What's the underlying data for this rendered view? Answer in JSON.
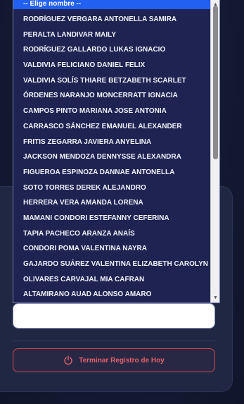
{
  "select": {
    "placeholder": "-- Elige nombre --",
    "options": [
      "RODRÍGUEZ VERGARA ANTONELLA SAMIRA",
      "PERALTA LANDIVAR MAILY",
      "RODRÍGUEZ GALLARDO LUKAS IGNACIO",
      "VALDIVIA FELICIANO DANIEL FELIX",
      "VALDIVIA SOLÍS THIARE BETZABETH SCARLET",
      "ÓRDENES NARANJO MONCERRATT IGNACIA",
      "CAMPOS PINTO MARIANA JOSE ANTONIA",
      "CARRASCO SÁNCHEZ EMANUEL ALEXANDER",
      "FRITIS ZEGARRA JAVIERA ANYELINA",
      "JACKSON MENDOZA DENNYSSE ALEXANDRA",
      "FIGUEROA ESPINOZA DANNAE ANTONELLA",
      "SOTO TORRES DEREK ALEJANDRO",
      "HERRERA VERA AMANDA LORENA",
      "MAMANI CONDORI ESTEFANNY CEFERINA",
      "TAPIA PACHECO ARANZA ANAÍS",
      "CONDORI POMA VALENTINA NAYRA",
      "GAJARDO SUÁREZ VALENTINA ELIZABETH CAROLYN",
      "OLIVARES CARVAJAL MIA CAFRAN",
      "ALTAMIRANO AUAD ALONSO AMARO"
    ]
  },
  "end_button": {
    "label": "Terminar Registro de Hoy",
    "icon": "power-icon"
  },
  "colors": {
    "background": "#141a33",
    "dropdown_bg": "#1f2352",
    "highlight": "#2160f0",
    "danger": "#d24a4f"
  }
}
